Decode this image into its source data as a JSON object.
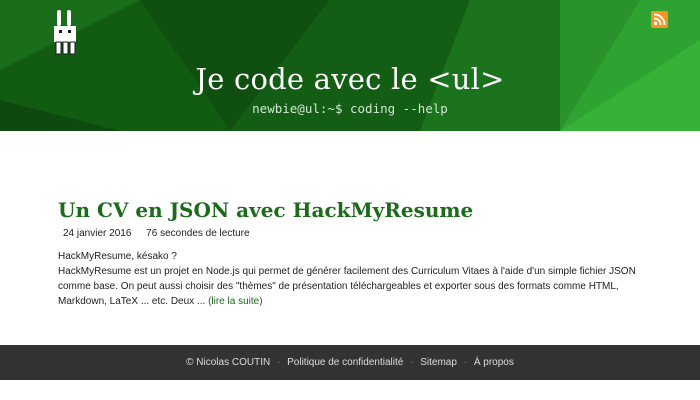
{
  "header": {
    "title": "Je code avec le <ul>",
    "tagline": "newbie@ul:~$ coding --help",
    "logo_icon": "bunny-icon",
    "rss_icon": "rss-icon"
  },
  "post": {
    "title": "Un CV en JSON avec HackMyResume",
    "date": "24 janvier 2016",
    "reading_time": "76 secondes de lecture",
    "excerpt_heading": "HackMyResume, késako ?",
    "excerpt_body": "HackMyResume est un projet en Node.js qui permet de générer facilement des Curriculum Vitaes à l'aide d'un simple fichier JSON comme base. On peut aussi choisir des \"thèmes\" de présentation téléchargeables et exporter sous des formats comme HTML, Markdown, LaTeX ... etc. Deux ...",
    "read_more": "(lire la suite)"
  },
  "footer": {
    "copyright_symbol": "©",
    "author": "Nicolas COUTIN",
    "links": [
      "Politique de confidentialité",
      "Sitemap",
      "À propos"
    ],
    "separator": "·"
  },
  "colors": {
    "header_green": "#1f7d1f",
    "accent_green": "#1b6b1b",
    "footer_bg": "#333333",
    "rss_orange": "#f7931e"
  }
}
